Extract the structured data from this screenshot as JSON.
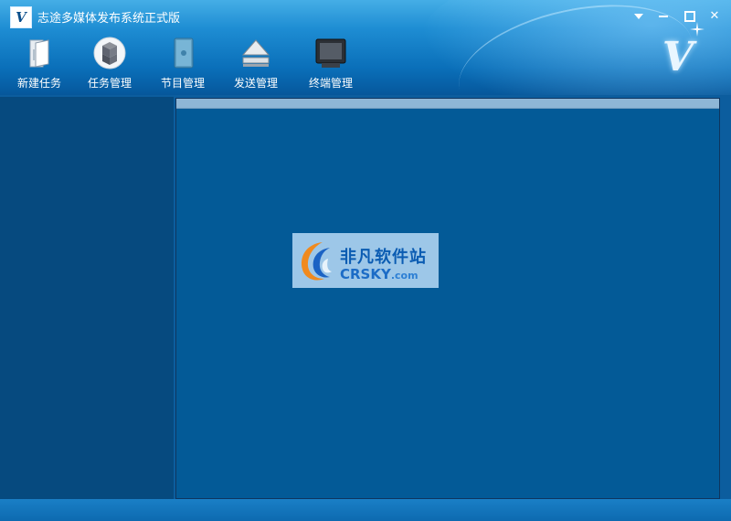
{
  "window": {
    "title": "志途多媒体发布系统正式版",
    "logo_glyph": "V",
    "controls": {
      "dropdown_icon": "dropdown-arrow-icon",
      "minimize_icon": "minimize-icon",
      "maximize_icon": "maximize-icon",
      "close_label": "✕"
    }
  },
  "toolbar": {
    "items": [
      {
        "label": "新建任务",
        "icon": "document-new-icon"
      },
      {
        "label": "任务管理",
        "icon": "cubes-icon"
      },
      {
        "label": "节目管理",
        "icon": "panel-icon"
      },
      {
        "label": "发送管理",
        "icon": "eject-send-icon"
      },
      {
        "label": "终端管理",
        "icon": "monitor-icon"
      }
    ]
  },
  "brand": {
    "mark": "V"
  },
  "watermark": {
    "cn": "非凡软件站",
    "en": "CRSKY",
    "en_suffix": ".com"
  },
  "colors": {
    "header_top": "#45aee6",
    "header_bottom": "#06579b",
    "sidebar": "#064a7f",
    "main": "#035a97",
    "strip": "#8eb6d6"
  }
}
